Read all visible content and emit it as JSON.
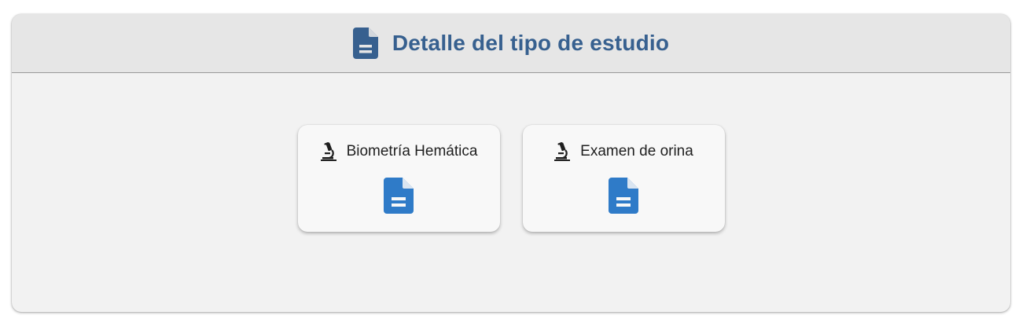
{
  "header": {
    "title": "Detalle del tipo de estudio",
    "icon": "document-icon",
    "title_color": "#37608f"
  },
  "cards": [
    {
      "label": "Biometría Hemática",
      "icon": "microscope-icon",
      "action_icon": "document-icon",
      "action_color": "#2f7bc8"
    },
    {
      "label": "Examen de orina",
      "icon": "microscope-icon",
      "action_icon": "document-icon",
      "action_color": "#2f7bc8"
    }
  ]
}
